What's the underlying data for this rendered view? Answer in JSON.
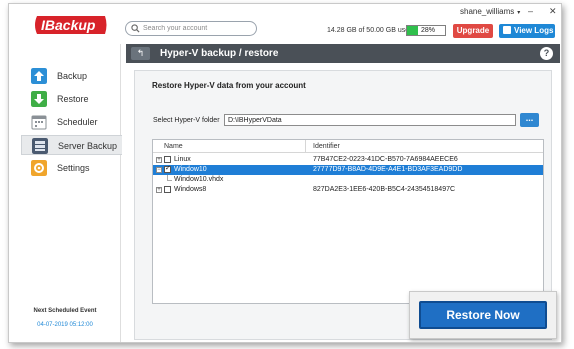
{
  "header": {
    "logo_text": "IBackup",
    "search_placeholder": "Search your account",
    "username": "shane_williams",
    "usage_text": "14.28 GB of 50.00 GB used",
    "usage_percent_label": "28%",
    "usage_fraction": 0.28,
    "upgrade_label": "Upgrade",
    "view_logs_label": "View Logs",
    "window_controls": {
      "minimize": "–",
      "close": "✕"
    },
    "colors": {
      "upgrade": "#e04943",
      "view_logs": "#1f88d6",
      "usage_fill": "#2fbf4c"
    }
  },
  "sidebar": {
    "items": [
      {
        "label": "Backup",
        "icon": "arrow-up-icon",
        "active": false,
        "color": "#2c8fd6"
      },
      {
        "label": "Restore",
        "icon": "arrow-down-icon",
        "active": false,
        "color": "#3fae46"
      },
      {
        "label": "Scheduler",
        "icon": "calendar-icon",
        "active": false,
        "color": "#8a9096"
      },
      {
        "label": "Server Backup",
        "icon": "server-icon",
        "active": true,
        "color": "#4a5a70"
      },
      {
        "label": "Settings",
        "icon": "gear-icon",
        "active": false,
        "color": "#f0a52c"
      }
    ],
    "next_event_title": "Next Scheduled Event",
    "next_event_datetime": "04-07-2019 05:12:00"
  },
  "main": {
    "title": "Hyper-V backup / restore",
    "back_symbol": "↰",
    "help_symbol": "?",
    "heading": "Restore Hyper-V data from your account",
    "folder_label": "Select Hyper-V folder",
    "folder_value": "D:\\IBHyperVData",
    "browse_label": "...",
    "table": {
      "columns": [
        "Name",
        "Identifier"
      ],
      "rows": [
        {
          "name": "Linux",
          "identifier": "77B47CE2-0223-41DC-B570-7A6984AEECE6",
          "level": 0,
          "expander": "+",
          "checked": false,
          "selected": false
        },
        {
          "name": "Window10",
          "identifier": "27777D97-B8AD-4D9E-A4E1-BD3AF3EAD9DD",
          "level": 0,
          "expander": "−",
          "checked": true,
          "selected": true
        },
        {
          "name": "Window10.vhdx",
          "identifier": "",
          "level": 1,
          "expander": "",
          "checked": false,
          "selected": false
        },
        {
          "name": "Windows8",
          "identifier": "827DA2E3-1EE6-420B-B5C4-24354518497C",
          "level": 0,
          "expander": "+",
          "checked": false,
          "selected": false
        }
      ]
    },
    "restore_now_label": "Restore Now"
  }
}
